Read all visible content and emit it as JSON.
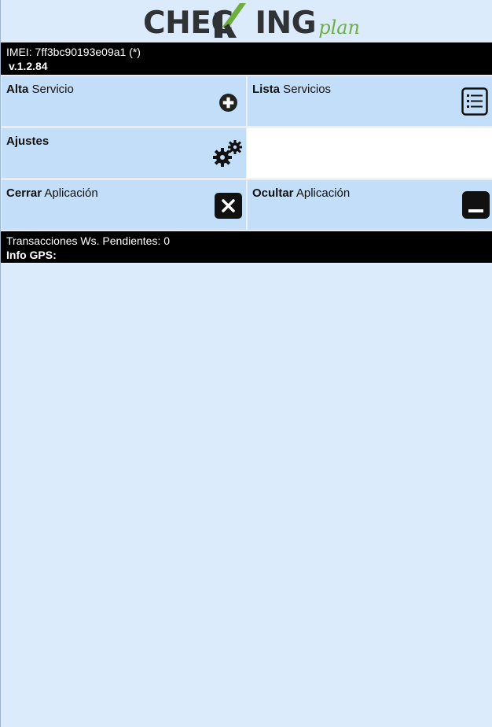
{
  "logo": {
    "main_text_part1": "CHEC",
    "main_text_part2": "ING",
    "sub_text": "plan",
    "colors": {
      "dark": "#2f3336",
      "green": "#6eae3f"
    }
  },
  "header": {
    "imei": "IMEI: 7ff3bc90193e09a1 (*)",
    "version": "v.1.2.84"
  },
  "tiles": {
    "alta": {
      "bold": "Alta",
      "rest": " Servicio",
      "icon": "plus-circle-icon"
    },
    "lista": {
      "bold": "Lista",
      "rest": " Servicios",
      "icon": "list-icon"
    },
    "ajustes": {
      "bold": "Ajustes",
      "rest": "",
      "icon": "gears-icon"
    },
    "cerrar": {
      "bold": "Cerrar",
      "rest": " Aplicación",
      "icon": "close-box-icon"
    },
    "ocultar": {
      "bold": "Ocultar",
      "rest": " Aplicación",
      "icon": "minimize-box-icon"
    }
  },
  "status": {
    "pending": "Transacciones Ws. Pendientes: 0",
    "gps": "Info GPS:"
  },
  "colors": {
    "background": "#dcebfc",
    "tile": "#c3def9",
    "bar": "#000000"
  }
}
